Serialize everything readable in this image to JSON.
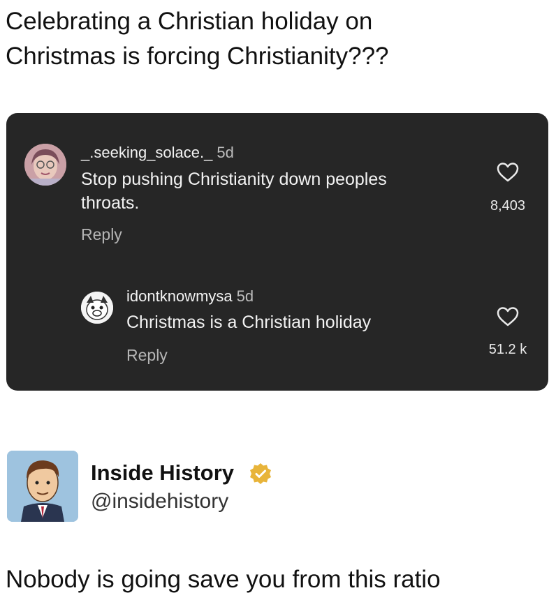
{
  "caption": {
    "line1": "Celebrating a Christian holiday on",
    "line2": "Christmas is forcing Christianity???"
  },
  "comments": [
    {
      "username": "_.seeking_solace._",
      "time": "5d",
      "text_line1": "Stop pushing Christianity down peoples",
      "text_line2": "throats.",
      "reply_label": "Reply",
      "likes": "8,403",
      "avatar_icon": "profile-photo"
    },
    {
      "username": "idontknowmysa",
      "time": "5d",
      "text_line1": "Christmas is a Christian holiday",
      "reply_label": "Reply",
      "likes": "51.2 k",
      "avatar_icon": "cartoon-dog-avatar"
    }
  ],
  "tweet": {
    "display_name": "Inside History",
    "handle": "@insidehistory",
    "text": "Nobody is going save you from this ratio",
    "verified_color": "#e8b43a",
    "avatar_icon": "cartoon-portrait-avatar"
  },
  "colors": {
    "card_bg": "#262626",
    "tweet_avatar_bg": "#9ec3df"
  }
}
